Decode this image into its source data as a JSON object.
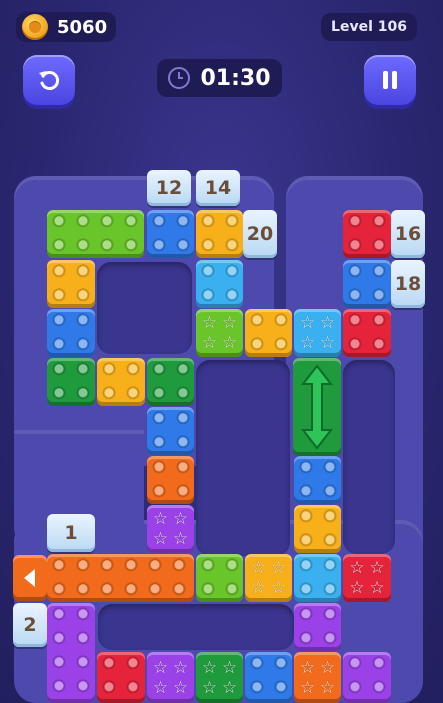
{
  "hud": {
    "coins": "5060",
    "level": "Level 106",
    "timer": "01:30"
  },
  "icons": {
    "coin": "coin-icon",
    "undo": "undo-icon",
    "pause": "pause-icon",
    "clock": "clock-icon"
  },
  "tiles": {
    "t12": "12",
    "t14": "14",
    "t20": "20",
    "t16": "16",
    "t18": "18",
    "t1": "1",
    "t2": "2"
  },
  "colors": {
    "red": "#e5233b",
    "orange": "#f26a1b",
    "yellow": "#f7b019",
    "green": "#6ac52a",
    "dark_green": "#1f9a3c",
    "blue": "#2f7ae8",
    "light_blue": "#3ab0f0",
    "purple": "#9a42e8"
  }
}
